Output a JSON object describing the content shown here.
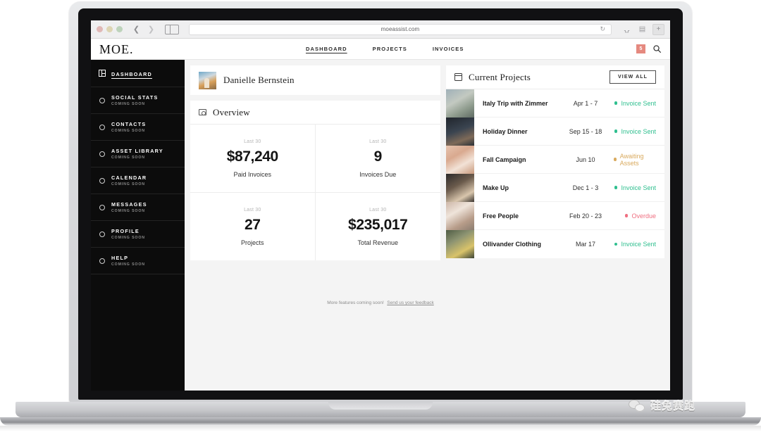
{
  "browser": {
    "url": "moeassist.com",
    "reload_icon": "reload-icon",
    "back_icon": "chevron-left-icon",
    "forward_icon": "chevron-right-icon",
    "sidebar_toggle_icon": "sidebar-toggle-icon",
    "share_icon": "share-icon",
    "tabs_icon": "tabs-icon",
    "new_tab_label": "+"
  },
  "header": {
    "logo": "MOE.",
    "nav": [
      {
        "label": "DASHBOARD",
        "active": true
      },
      {
        "label": "PROJECTS",
        "active": false
      },
      {
        "label": "INVOICES",
        "active": false
      }
    ],
    "badge_count": "5",
    "search_icon": "search-icon"
  },
  "sidebar": {
    "items": [
      {
        "label": "DASHBOARD",
        "sub": "",
        "icon": "grid-icon",
        "active": true
      },
      {
        "label": "SOCIAL STATS",
        "sub": "COMING SOON",
        "icon": "circle-icon",
        "active": false
      },
      {
        "label": "CONTACTS",
        "sub": "COMING SOON",
        "icon": "circle-icon",
        "active": false
      },
      {
        "label": "ASSET LIBRARY",
        "sub": "COMING SOON",
        "icon": "circle-icon",
        "active": false
      },
      {
        "label": "CALENDAR",
        "sub": "COMING SOON",
        "icon": "circle-icon",
        "active": false
      },
      {
        "label": "MESSAGES",
        "sub": "COMING SOON",
        "icon": "circle-icon",
        "active": false
      },
      {
        "label": "PROFILE",
        "sub": "COMING SOON",
        "icon": "circle-icon",
        "active": false
      },
      {
        "label": "HELP",
        "sub": "COMING SOON",
        "icon": "circle-icon",
        "active": false
      }
    ]
  },
  "user": {
    "name": "Danielle Bernstein",
    "avatar_icon": "user-avatar"
  },
  "overview": {
    "title": "Overview",
    "icon": "overview-icon",
    "stats": [
      {
        "period": "Last 30",
        "value": "$87,240",
        "label": "Paid Invoices"
      },
      {
        "period": "Last 30",
        "value": "9",
        "label": "Invoices Due"
      },
      {
        "period": "Last 30",
        "value": "27",
        "label": "Projects"
      },
      {
        "period": "Last 30",
        "value": "$235,017",
        "label": "Total Revenue"
      }
    ]
  },
  "projects": {
    "title": "Current Projects",
    "icon": "calendar-icon",
    "view_all_label": "VIEW ALL",
    "rows": [
      {
        "name": "Italy Trip with Zimmer",
        "date": "Apr 1 - 7",
        "status": "Invoice Sent",
        "color": "#2fbf8f"
      },
      {
        "name": "Holiday Dinner",
        "date": "Sep 15 - 18",
        "status": "Invoice Sent",
        "color": "#2fbf8f"
      },
      {
        "name": "Fall Campaign",
        "date": "Jun 10",
        "status": "Awaiting Assets",
        "color": "#d9aa5e"
      },
      {
        "name": "Make Up",
        "date": "Dec 1 - 3",
        "status": "Invoice Sent",
        "color": "#2fbf8f"
      },
      {
        "name": "Free People",
        "date": "Feb 20 - 23",
        "status": "Overdue",
        "color": "#ef6f81"
      },
      {
        "name": "Ollivander Clothing",
        "date": "Mar 17",
        "status": "Invoice Sent",
        "color": "#2fbf8f"
      }
    ]
  },
  "footer": {
    "text": "More features coming soon!",
    "link": "Send us your feedback"
  },
  "watermark": {
    "text": "硅兔赛跑",
    "icon": "wechat-icon"
  }
}
